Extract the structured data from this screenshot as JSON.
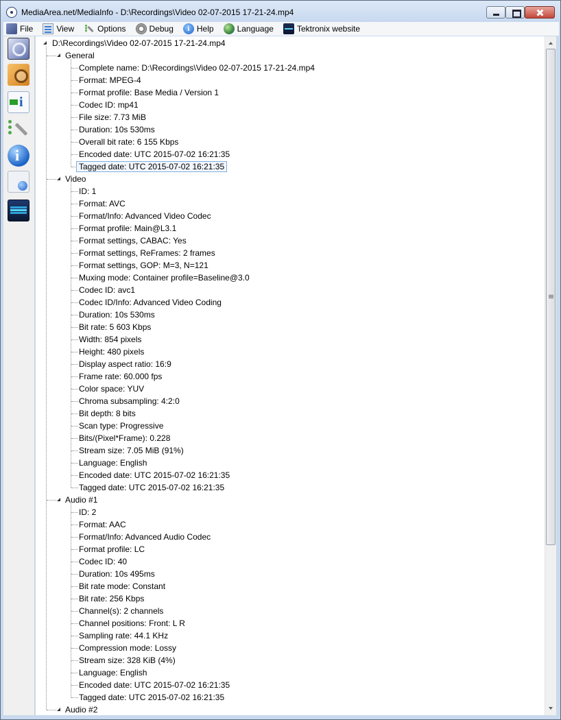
{
  "window": {
    "title": "MediaArea.net/MediaInfo - D:\\Recordings\\Video 02-07-2015 17-21-24.mp4"
  },
  "menu": [
    {
      "label": "File",
      "icon": "file-icon"
    },
    {
      "label": "View",
      "icon": "view-icon"
    },
    {
      "label": "Options",
      "icon": "options-icon"
    },
    {
      "label": "Debug",
      "icon": "debug-icon"
    },
    {
      "label": "Help",
      "icon": "help-icon"
    },
    {
      "label": "Language",
      "icon": "language-icon"
    },
    {
      "label": "Tektronix website",
      "icon": "tektronix-icon"
    }
  ],
  "toolbar": [
    {
      "name": "open-file-button",
      "icon": "open-file-icon"
    },
    {
      "name": "open-folder-button",
      "icon": "open-folder-icon"
    },
    {
      "name": "export-button",
      "icon": "export-icon"
    },
    {
      "name": "preferences-button",
      "icon": "preferences-icon"
    },
    {
      "name": "about-button",
      "icon": "info-icon"
    },
    {
      "name": "website-button",
      "icon": "web-icon"
    },
    {
      "name": "tektronix-button",
      "icon": "tektronix-icon"
    }
  ],
  "tree": {
    "root": "D:\\Recordings\\Video 02-07-2015 17-21-24.mp4",
    "sections": [
      {
        "label": "General",
        "items": [
          "Complete name: D:\\Recordings\\Video 02-07-2015 17-21-24.mp4",
          "Format: MPEG-4",
          "Format profile: Base Media / Version 1",
          "Codec ID: mp41",
          "File size: 7.73 MiB",
          "Duration: 10s 530ms",
          "Overall bit rate: 6 155 Kbps",
          "Encoded date: UTC 2015-07-02 16:21:35",
          "Tagged date: UTC 2015-07-02 16:21:35"
        ]
      },
      {
        "label": "Video",
        "items": [
          "ID: 1",
          "Format: AVC",
          "Format/Info: Advanced Video Codec",
          "Format profile: Main@L3.1",
          "Format settings, CABAC: Yes",
          "Format settings, ReFrames: 2 frames",
          "Format settings, GOP: M=3, N=121",
          "Muxing mode: Container profile=Baseline@3.0",
          "Codec ID: avc1",
          "Codec ID/Info: Advanced Video Coding",
          "Duration: 10s 530ms",
          "Bit rate: 5 603 Kbps",
          "Width: 854 pixels",
          "Height: 480 pixels",
          "Display aspect ratio: 16:9",
          "Frame rate: 60.000 fps",
          "Color space: YUV",
          "Chroma subsampling: 4:2:0",
          "Bit depth: 8 bits",
          "Scan type: Progressive",
          "Bits/(Pixel*Frame): 0.228",
          "Stream size: 7.05 MiB (91%)",
          "Language: English",
          "Encoded date: UTC 2015-07-02 16:21:35",
          "Tagged date: UTC 2015-07-02 16:21:35"
        ]
      },
      {
        "label": "Audio #1",
        "items": [
          "ID: 2",
          "Format: AAC",
          "Format/Info: Advanced Audio Codec",
          "Format profile: LC",
          "Codec ID: 40",
          "Duration: 10s 495ms",
          "Bit rate mode: Constant",
          "Bit rate: 256 Kbps",
          "Channel(s): 2 channels",
          "Channel positions: Front: L R",
          "Sampling rate: 44.1 KHz",
          "Compression mode: Lossy",
          "Stream size: 328 KiB (4%)",
          "Language: English",
          "Encoded date: UTC 2015-07-02 16:21:35",
          "Tagged date: UTC 2015-07-02 16:21:35"
        ]
      },
      {
        "label": "Audio #2",
        "items": []
      }
    ]
  }
}
